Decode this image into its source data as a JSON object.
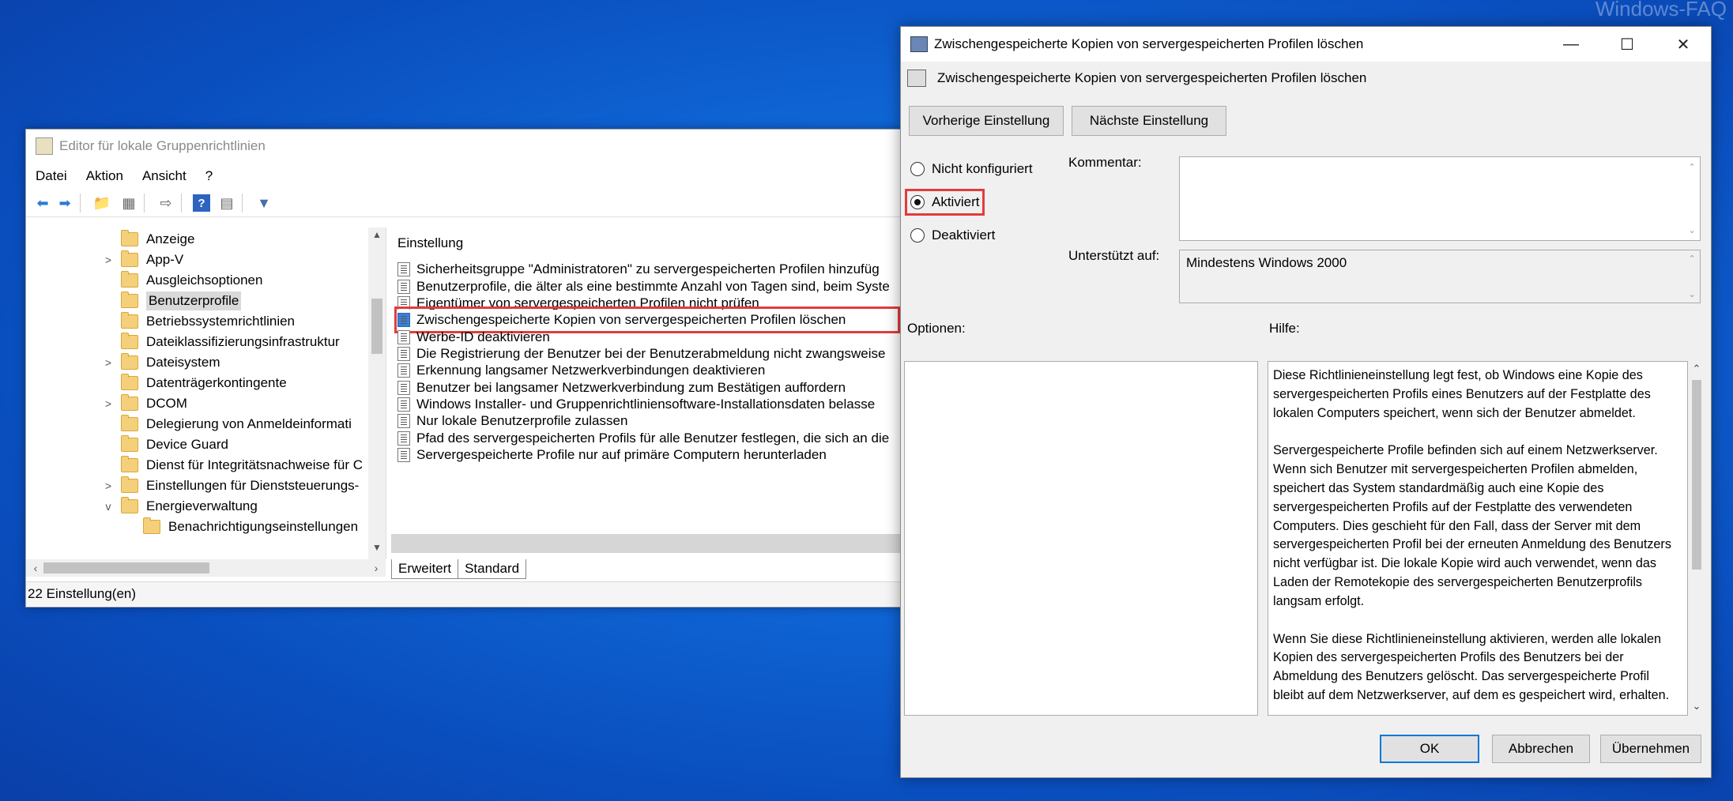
{
  "watermark": "Windows-FAQ",
  "editor": {
    "title": "Editor für lokale Gruppenrichtlinien",
    "menu": [
      "Datei",
      "Aktion",
      "Ansicht",
      "?"
    ],
    "tree": [
      {
        "label": "Anzeige",
        "chev": ""
      },
      {
        "label": "App-V",
        "chev": ">"
      },
      {
        "label": "Ausgleichsoptionen",
        "chev": ""
      },
      {
        "label": "Benutzerprofile",
        "chev": ""
      },
      {
        "label": "Betriebssystemrichtlinien",
        "chev": ""
      },
      {
        "label": "Dateiklassifizierungsinfrastruktur",
        "chev": ""
      },
      {
        "label": "Dateisystem",
        "chev": ">"
      },
      {
        "label": "Datenträgerkontingente",
        "chev": ""
      },
      {
        "label": "DCOM",
        "chev": ">"
      },
      {
        "label": "Delegierung von Anmeldeinformati",
        "chev": ""
      },
      {
        "label": "Device Guard",
        "chev": ""
      },
      {
        "label": "Dienst für Integritätsnachweise für C",
        "chev": ""
      },
      {
        "label": "Einstellungen für Dienststeuerungs-",
        "chev": ">"
      },
      {
        "label": "Energieverwaltung",
        "chev": "v"
      },
      {
        "label": "Benachrichtigungseinstellungen",
        "chev": ""
      }
    ],
    "list_header": "Einstellung",
    "rows": [
      "Sicherheitsgruppe \"Administratoren\" zu servergespeicherten Profilen hinzufüg",
      "Benutzerprofile, die älter als eine bestimmte Anzahl von Tagen sind, beim Syste",
      "Eigentümer von servergespeicherten Profilen nicht prüfen",
      "Zwischengespeicherte Kopien von servergespeicherten Profilen löschen",
      "Werbe-ID deaktivieren",
      "Die Registrierung der Benutzer bei der Benutzerabmeldung nicht zwangsweise",
      "Erkennung langsamer Netzwerkverbindungen deaktivieren",
      "Benutzer bei langsamer Netzwerkverbindung zum Bestätigen auffordern",
      "Windows Installer- und Gruppenrichtliniensoftware-Installationsdaten belasse",
      "Nur lokale Benutzerprofile zulassen",
      "Pfad des servergespeicherten Profils für alle Benutzer festlegen, die sich an die",
      "Servergespeicherte Profile nur auf primäre Computern herunterladen"
    ],
    "tabs": [
      "Erweitert",
      "Standard"
    ],
    "status": "22 Einstellung(en)"
  },
  "dialog": {
    "title": "Zwischengespeicherte Kopien von servergespeicherten Profilen löschen",
    "header": "Zwischengespeicherte Kopien von servergespeicherten Profilen löschen",
    "prev_button": "Vorherige Einstellung",
    "next_button": "Nächste Einstellung",
    "radio_not_configured": "Nicht konfiguriert",
    "radio_enabled": "Aktiviert",
    "radio_disabled": "Deaktiviert",
    "comment_label": "Kommentar:",
    "comment_value": "",
    "supported_label": "Unterstützt auf:",
    "supported_value": "Mindestens Windows 2000",
    "options_label": "Optionen:",
    "help_label": "Hilfe:",
    "help_paragraphs": [
      "Diese Richtlinieneinstellung legt fest, ob Windows eine Kopie des servergespeicherten Profils eines Benutzers auf der Festplatte des lokalen Computers speichert, wenn sich der Benutzer abmeldet.",
      "Servergespeicherte Profile befinden sich auf einem Netzwerkserver. Wenn sich Benutzer mit servergespeicherten Profilen abmelden, speichert das System standardmäßig auch eine Kopie des servergespeicherten Profils auf der Festplatte des verwendeten Computers. Dies geschieht für den Fall, dass der Server mit dem servergespeicherten Profil bei der erneuten Anmeldung des Benutzers nicht verfügbar ist. Die lokale Kopie wird auch verwendet, wenn das Laden der Remotekopie des servergespeicherten Benutzerprofils langsam erfolgt.",
      "Wenn Sie diese Richtlinieneinstellung aktivieren, werden alle lokalen Kopien des servergespeicherten Profils des Benutzers bei der Abmeldung des Benutzers gelöscht. Das servergespeicherte Profil bleibt auf dem Netzwerkserver, auf dem es gespeichert wird, erhalten."
    ],
    "ok_button": "OK",
    "cancel_button": "Abbrechen",
    "apply_button": "Übernehmen"
  }
}
